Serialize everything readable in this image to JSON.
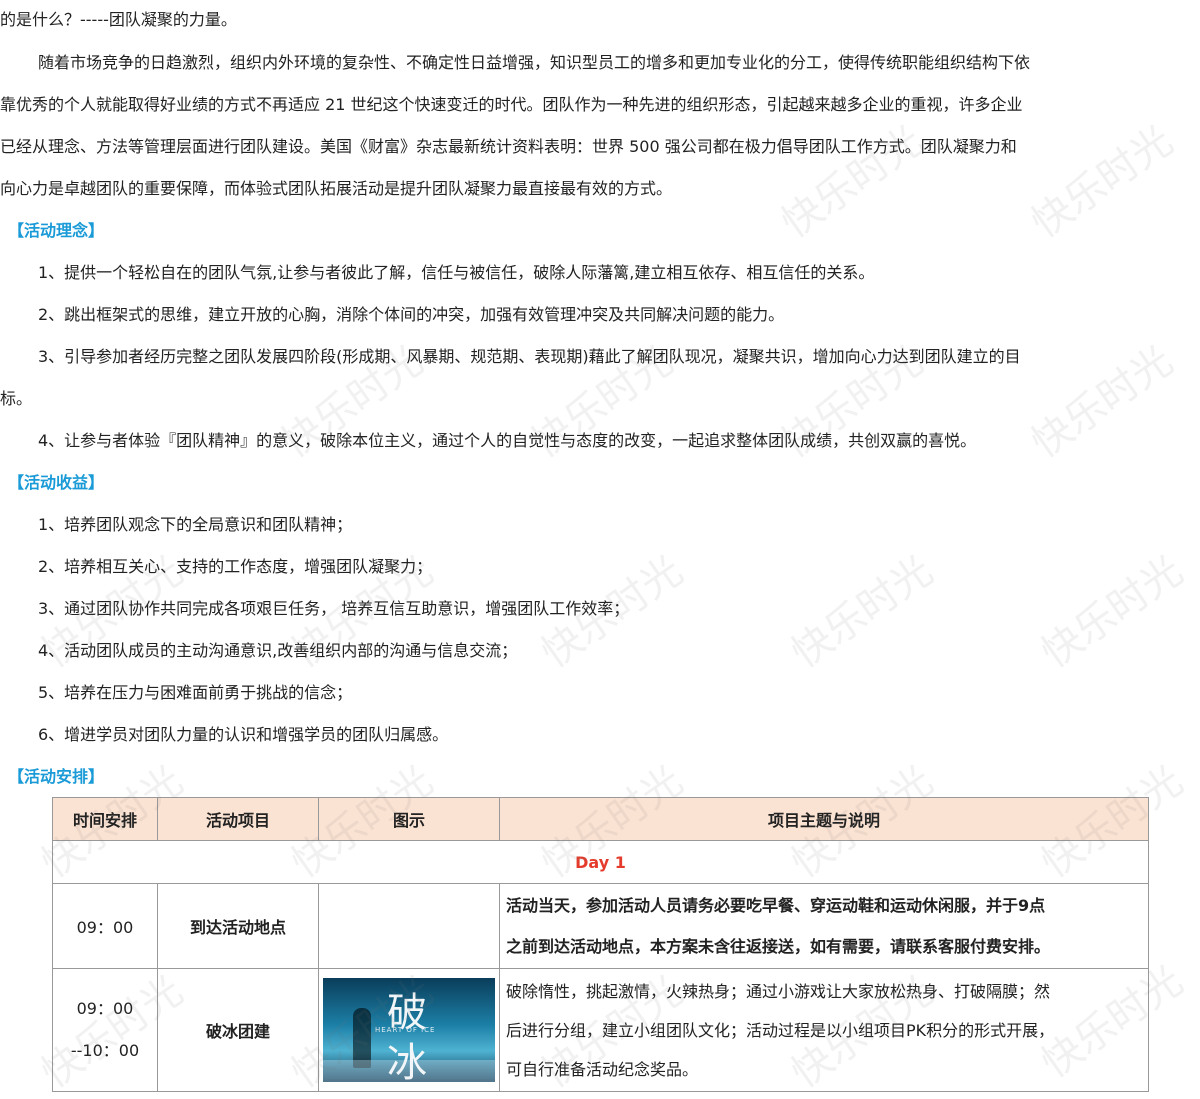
{
  "intro": {
    "line0": "的是什么？-----团队凝聚的力量。",
    "line1": "随着市场竞争的日趋激烈，组织内外环境的复杂性、不确定性日益增强，知识型员工的增多和更加专业化的分工，使得传统职能组织结构下依",
    "line2": "靠优秀的个人就能取得好业绩的方式不再适应 21 世纪这个快速变迁的时代。团队作为一种先进的组织形态，引起越来越多企业的重视，许多企业",
    "line3": "已经从理念、方法等管理层面进行团队建设。美国《财富》杂志最新统计资料表明：世界 500 强公司都在极力倡导团队工作方式。团队凝聚力和",
    "line4": "向心力是卓越团队的重要保障，而体验式团队拓展活动是提升团队凝聚力最直接最有效的方式。"
  },
  "philosophy": {
    "heading": "【活动理念】",
    "items": [
      "1、提供一个轻松自在的团队气氛,让参与者彼此了解，信任与被信任，破除人际藩篱,建立相互依存、相互信任的关系。",
      "2、跳出框架式的思维，建立开放的心胸，消除个体间的冲突，加强有效管理冲突及共同解决问题的能力。",
      "3、引导参加者经历完整之团队发展四阶段(形成期、风暴期、规范期、表现期)藉此了解团队现况，凝聚共识，增加向心力达到团队建立的目",
      "标。",
      "4、让参与者体验『团队精神』的意义，破除本位主义，通过个人的自觉性与态度的改变，一起追求整体团队成绩，共创双赢的喜悦。"
    ]
  },
  "benefits": {
    "heading": "【活动收益】",
    "items": [
      "1、培养团队观念下的全局意识和团队精神；",
      "2、培养相互关心、支持的工作态度，增强团队凝聚力；",
      "3、通过团队协作共同完成各项艰巨任务，  培养互信互助意识，增强团队工作效率；",
      "4、活动团队成员的主动沟通意识,改善组织内部的沟通与信息交流；",
      "5、培养在压力与困难面前勇于挑战的信念；",
      "6、增进学员对团队力量的认识和增强学员的团队归属感。"
    ]
  },
  "schedule": {
    "heading": "【活动安排】",
    "headers": [
      "时间安排",
      "活动项目",
      "图示",
      "项目主题与说明"
    ],
    "day": "Day 1",
    "rows": [
      {
        "time": "09：00",
        "item": "到达活动地点",
        "desc_lines": [
          "活动当天，参加活动人员请务必要吃早餐、穿运动鞋和运动休闲服，并于9点",
          "之前到达活动地点，本方案未含往返接送，如有需要，请联系客服付费安排。"
        ]
      },
      {
        "time_lines": [
          "09：00",
          "--10：00"
        ],
        "item": "破冰团建",
        "image": {
          "char1": "破",
          "char2": "冰",
          "subtitle": "HEART OF ICE"
        },
        "desc_lines": [
          "破除惰性，挑起激情，火辣热身；通过小游戏让大家放松热身、打破隔膜；然",
          "后进行分组，建立小组团队文化；活动过程是以小组项目PK积分的形式开展，",
          "可自行准备活动纪念奖品。"
        ]
      }
    ]
  },
  "watermark": "快乐时光",
  "colors": {
    "heading": "#1a9bd7",
    "day": "#e53b2c",
    "table_header_bg": "#fbe3d3"
  }
}
